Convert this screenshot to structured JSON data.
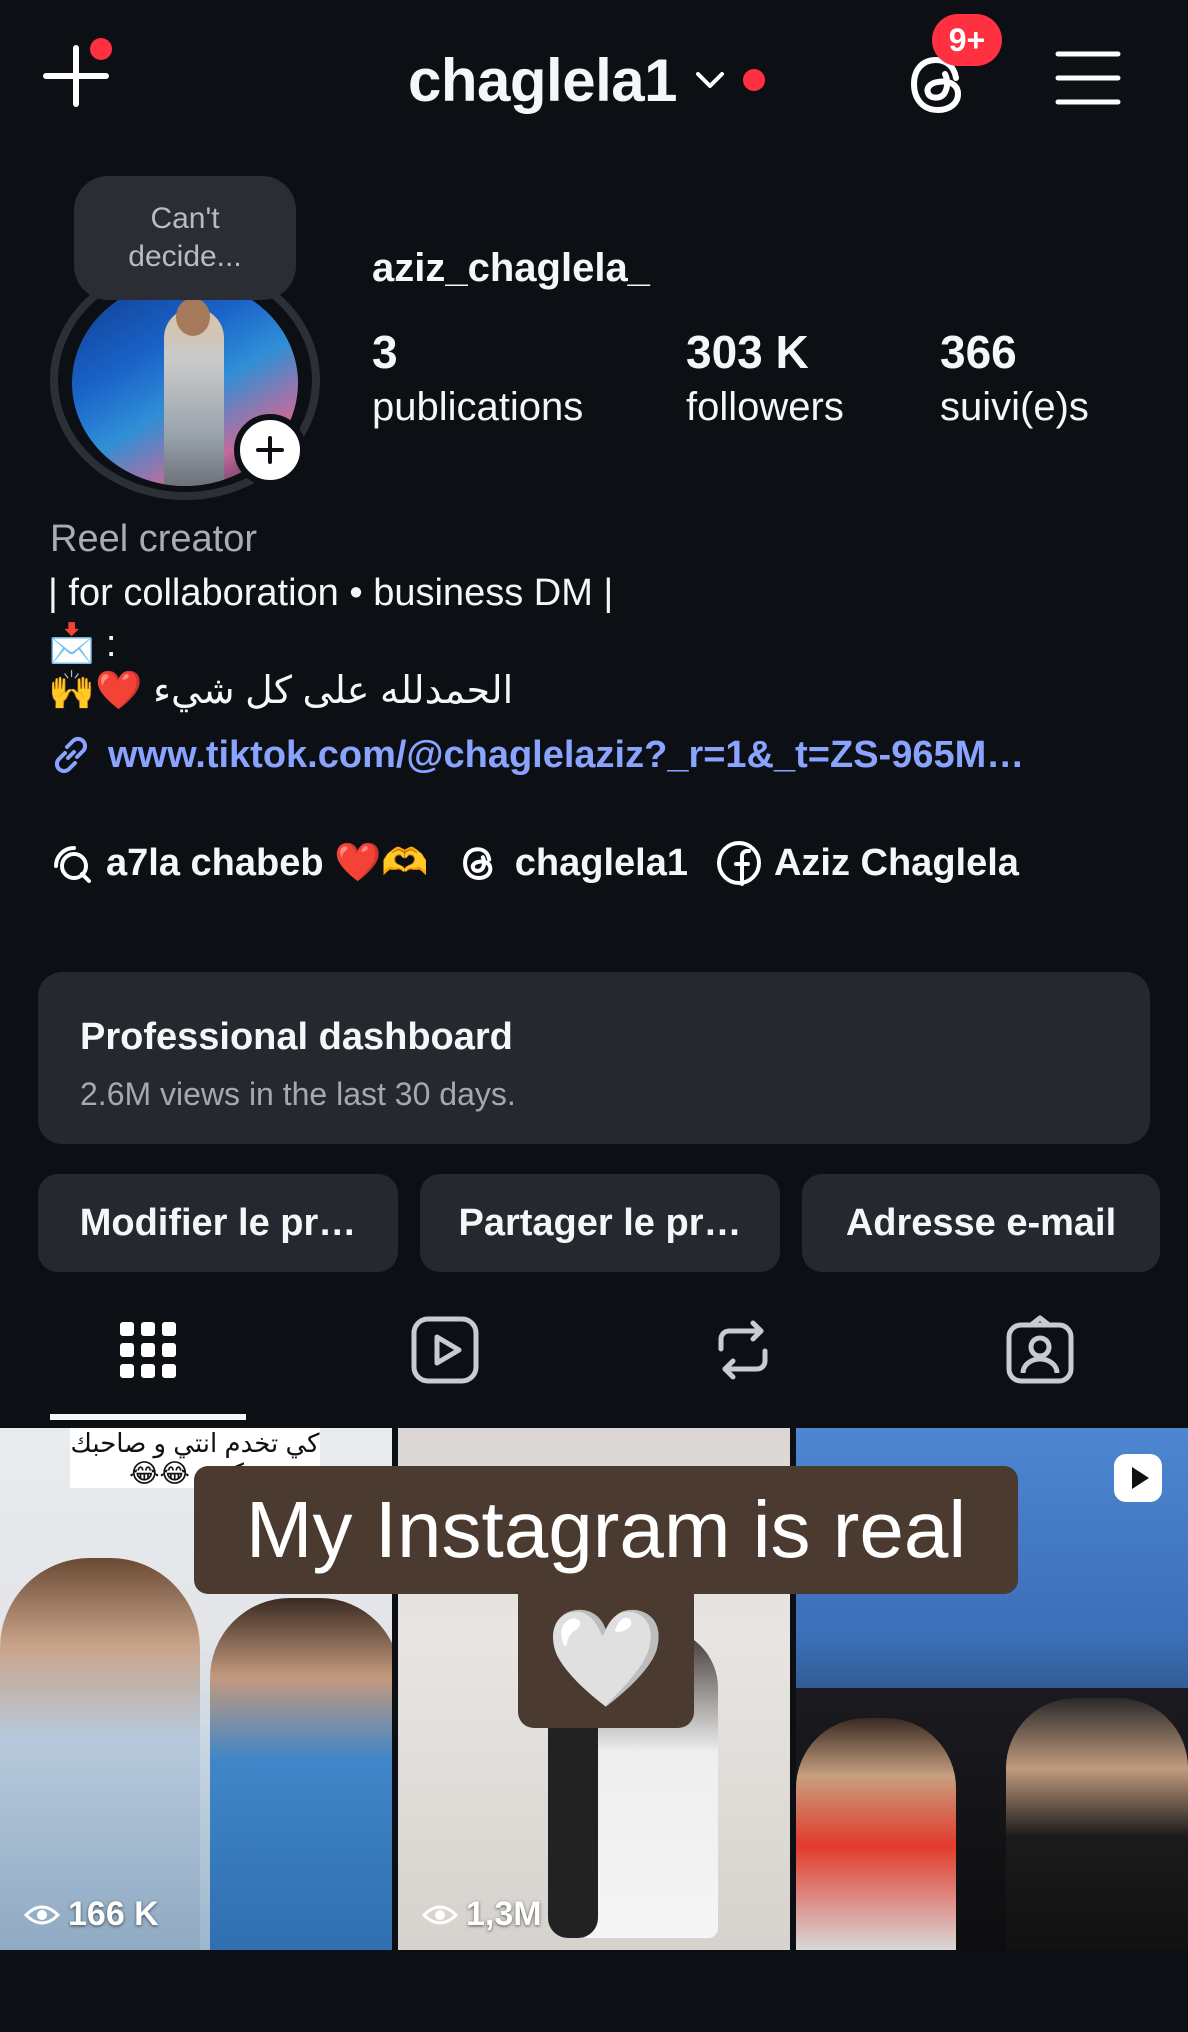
{
  "header": {
    "username": "chaglela1",
    "threads_badge": "9+"
  },
  "profile": {
    "note": "Can't decide...",
    "handle": "aziz_chaglela_",
    "stats": [
      {
        "value": "3",
        "label": "publications"
      },
      {
        "value": "303 K",
        "label": "followers"
      },
      {
        "value": "366",
        "label": "suivi(e)s"
      }
    ]
  },
  "bio": {
    "category": "Reel creator",
    "line1": "| for collaboration • business DM |",
    "line2": "📩 :",
    "line3": "الحمدلله على كل شيء ❤️🙌",
    "link": "www.tiktok.com/@chaglelaziz?_r=1&_t=ZS-965M…"
  },
  "chips": [
    {
      "icon": "broadcast-channel-icon",
      "label": "a7la chabeb ❤️🫶"
    },
    {
      "icon": "threads-icon",
      "label": "chaglela1"
    },
    {
      "icon": "facebook-icon",
      "label": "Aziz Chaglela"
    }
  ],
  "dashboard": {
    "title": "Professional dashboard",
    "subtitle": "2.6M views in the last 30 days."
  },
  "buttons": {
    "edit": "Modifier le pr…",
    "share": "Partager le pr…",
    "email": "Adresse e-mail"
  },
  "tabs": [
    "grid-icon",
    "reels-icon",
    "reposts-icon",
    "tagged-icon"
  ],
  "posts": [
    {
      "caption_ar": "كي تخدم انتي و صاحبك تتكيفو 😂😂",
      "views": "166 K"
    },
    {
      "views": "1,3M"
    },
    {
      "reel": true
    }
  ],
  "overlay": {
    "caption": "My Instagram is real",
    "heart": "🤍"
  },
  "colors": {
    "background": "#0c0f14",
    "card": "#25292f",
    "link": "#8aa3ff",
    "badge": "#ff3040"
  }
}
